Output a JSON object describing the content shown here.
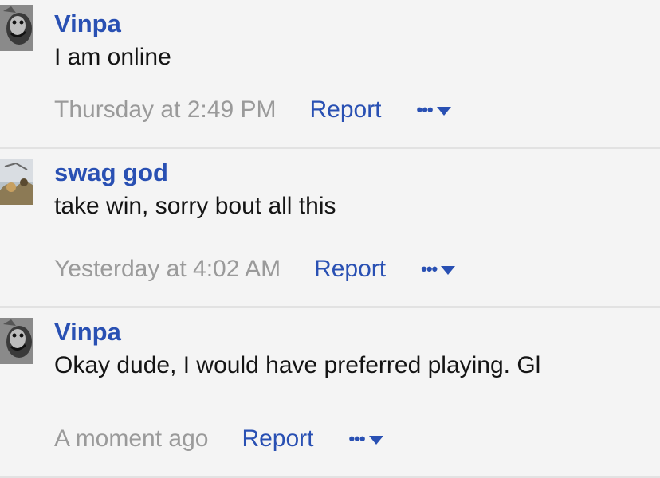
{
  "comments": [
    {
      "author": "Vinpa",
      "message": "I am online",
      "time": "Thursday at 2:49 PM",
      "report_label": "Report",
      "more_label": "•••"
    },
    {
      "author": "swag god",
      "message": "take win, sorry bout all this",
      "time": "Yesterday at 4:02 AM",
      "report_label": "Report",
      "more_label": "•••"
    },
    {
      "author": "Vinpa",
      "message": "Okay dude, I would have preferred playing. Gl",
      "time": "A moment ago",
      "report_label": "Report",
      "more_label": "•••"
    }
  ],
  "colors": {
    "link": "#2950b3",
    "timestamp": "#9a9a9a",
    "text": "#141414",
    "background": "#f4f4f4",
    "divider": "#e2e2e2"
  }
}
